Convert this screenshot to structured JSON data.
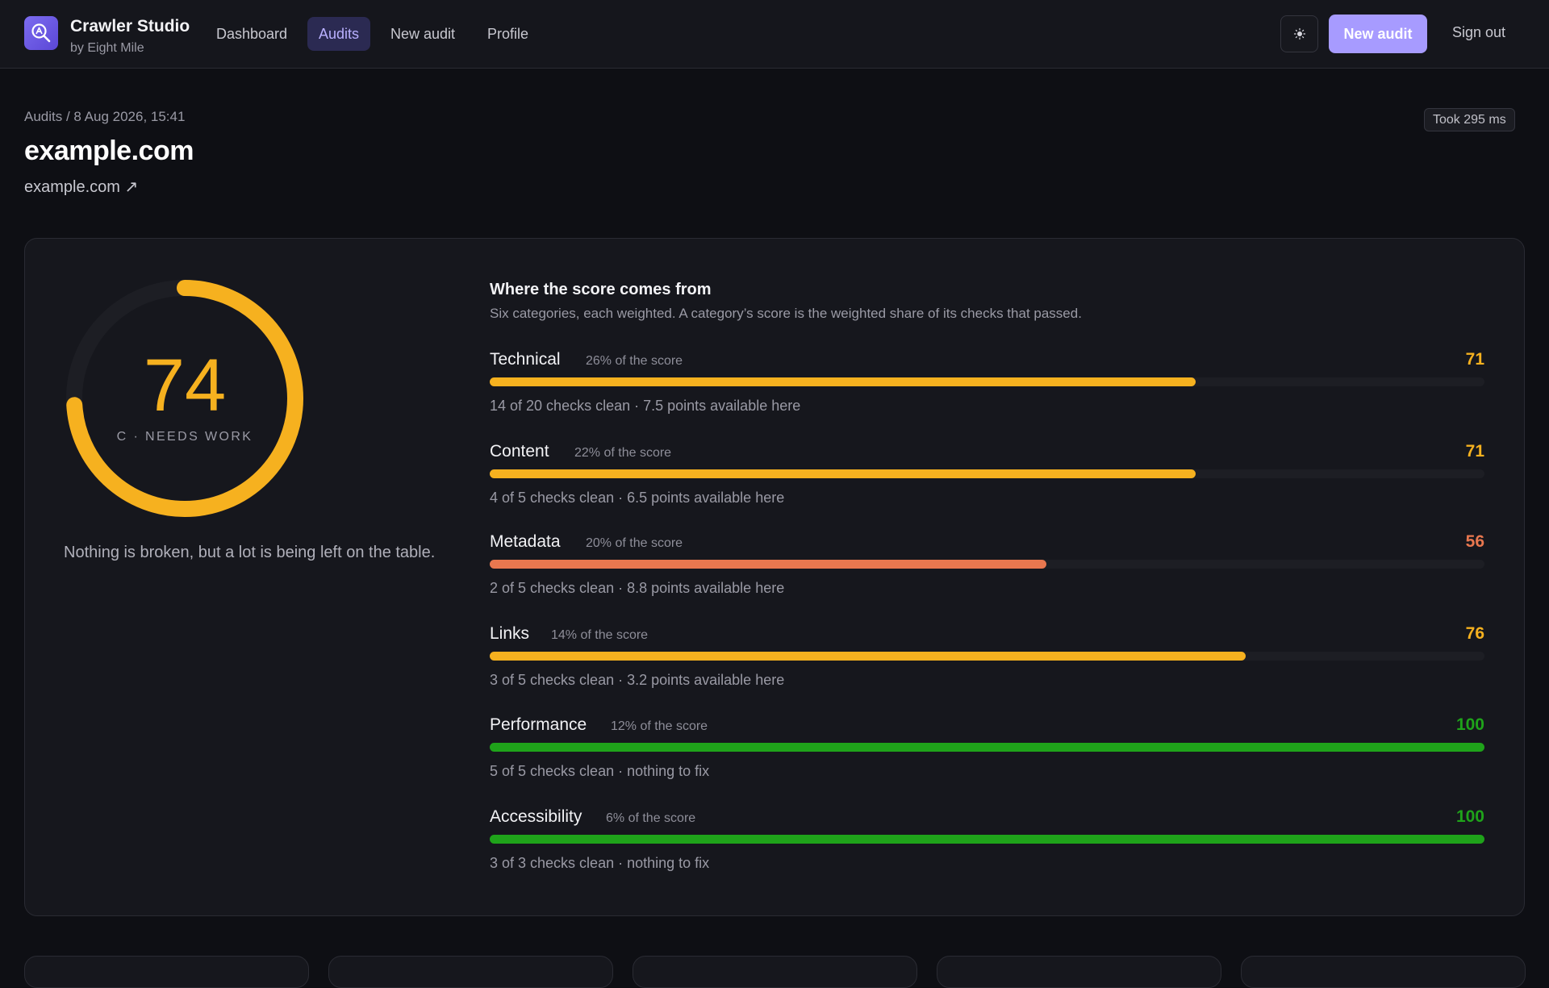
{
  "header": {
    "app_name": "Crawler Studio",
    "app_sub": "by Eight Mile",
    "nav": [
      {
        "label": "Dashboard",
        "active": false
      },
      {
        "label": "Audits",
        "active": true
      },
      {
        "label": "New audit",
        "active": false
      },
      {
        "label": "Profile",
        "active": false
      }
    ],
    "theme_icon": "sun-icon",
    "new_audit_label": "New audit",
    "sign_out_label": "Sign out"
  },
  "page": {
    "breadcrumb": "Audits / 8 Aug 2026, 15:41",
    "title": "example.com",
    "site_link": "example.com ↗",
    "took": "Took 295 ms"
  },
  "score": {
    "value": "74",
    "fraction": 0.74,
    "grade": "C · NEEDS WORK",
    "summary": "Nothing is broken, but a lot is being left on the table."
  },
  "breakdown": {
    "title": "Where the score comes from",
    "subtitle": "Six categories, each weighted. A category’s score is the weighted share of its checks that passed.",
    "categories": [
      {
        "name": "Technical",
        "weight": "26% of the score",
        "score": "71",
        "value": 71,
        "color": "#f6b11f",
        "detail": "14 of 20 checks clean · 7.5 points available here"
      },
      {
        "name": "Content",
        "weight": "22% of the score",
        "score": "71",
        "value": 71,
        "color": "#f6b11f",
        "detail": "4 of 5 checks clean · 6.5 points available here"
      },
      {
        "name": "Metadata",
        "weight": "20% of the score",
        "score": "56",
        "value": 56,
        "color": "#e8774f",
        "detail": "2 of 5 checks clean · 8.8 points available here"
      },
      {
        "name": "Links",
        "weight": "14% of the score",
        "score": "76",
        "value": 76,
        "color": "#f6b11f",
        "detail": "3 of 5 checks clean · 3.2 points available here"
      },
      {
        "name": "Performance",
        "weight": "12% of the score",
        "score": "100",
        "value": 100,
        "color": "#1fa31a",
        "detail": "5 of 5 checks clean · nothing to fix"
      },
      {
        "name": "Accessibility",
        "weight": "6% of the score",
        "score": "100",
        "value": 100,
        "color": "#1fa31a",
        "detail": "3 of 3 checks clean · nothing to fix"
      }
    ]
  },
  "colors": {
    "accent": "#a79bff",
    "warn": "#f6b11f",
    "bad": "#e8774f",
    "good": "#1fa31a"
  }
}
